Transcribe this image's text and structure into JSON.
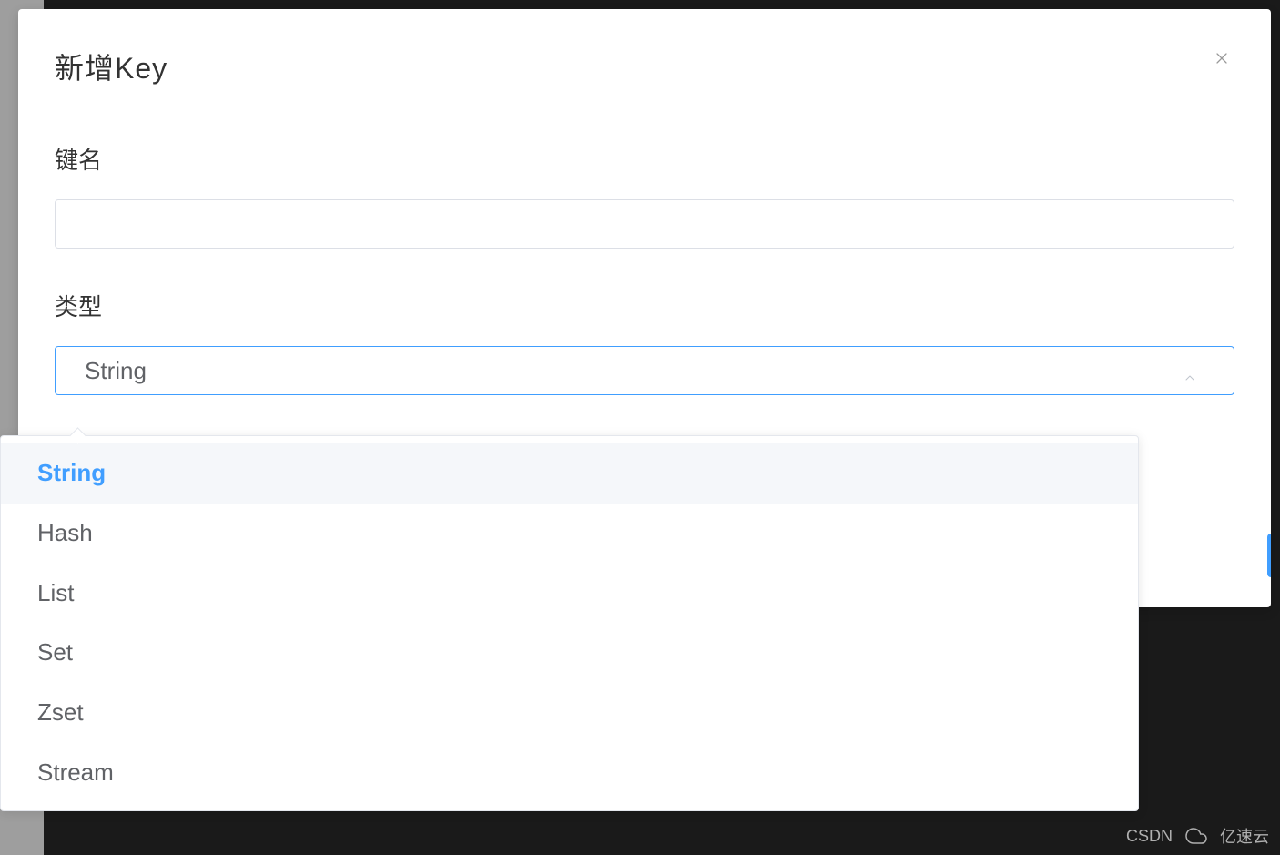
{
  "modal": {
    "title": "新增Key",
    "fields": {
      "keyName": {
        "label": "键名",
        "value": ""
      },
      "type": {
        "label": "类型",
        "selected": "String",
        "options": [
          "String",
          "Hash",
          "List",
          "Set",
          "Zset",
          "Stream"
        ]
      }
    }
  },
  "watermark": {
    "left": "CSDN",
    "right": "亿速云"
  }
}
